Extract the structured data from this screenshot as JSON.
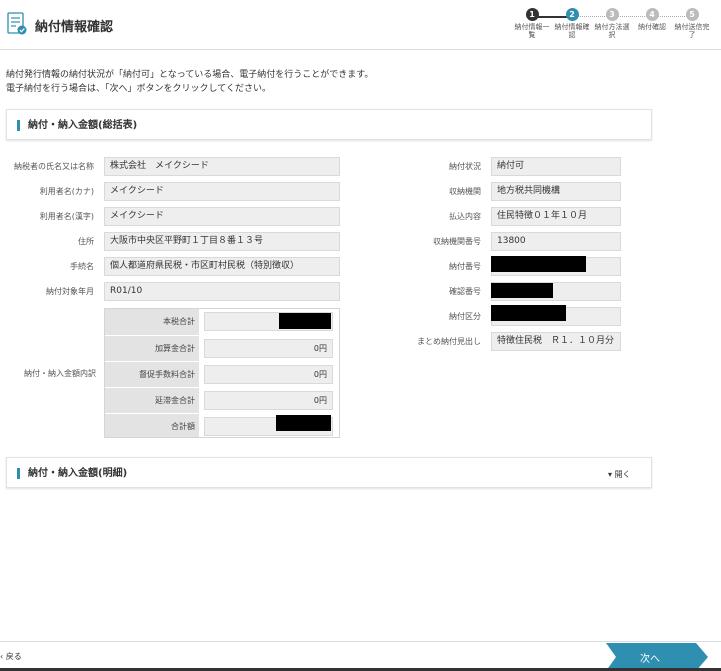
{
  "header": {
    "title": "納付情報確認"
  },
  "steps": [
    {
      "num": "1",
      "label": "納付情報一覧",
      "state": "done"
    },
    {
      "num": "2",
      "label": "納付情報確認",
      "state": "current"
    },
    {
      "num": "3",
      "label": "納付方法選択",
      "state": "todo"
    },
    {
      "num": "4",
      "label": "納付確認",
      "state": "todo"
    },
    {
      "num": "5",
      "label": "納付送信完了",
      "state": "todo"
    }
  ],
  "colors": {
    "done": "#333333",
    "current": "#2e8fb0",
    "todo": "#bbbbbb",
    "next": "#2e8fb0"
  },
  "intro": {
    "line1": "納付発行情報の納付状況が「納付可」となっている場合、電子納付を行うことができます。",
    "line2": "電子納付を行う場合は、「次へ」ボタンをクリックしてください。"
  },
  "summary": {
    "title": "納付・納入金額(総括表)",
    "left": [
      {
        "label": "納税者の氏名又は名称",
        "value": "株式会社　メイクシード"
      },
      {
        "label": "利用者名(カナ)",
        "value": "メイクシード"
      },
      {
        "label": "利用者名(漢字)",
        "value": "メイクシード"
      },
      {
        "label": "住所",
        "value": "大阪市中央区平野町１丁目８番１３号"
      },
      {
        "label": "手続名",
        "value": "個人都道府県民税・市区町村民税（特別徴収）"
      },
      {
        "label": "納付対象年月",
        "value": "R01/10"
      }
    ],
    "right": [
      {
        "label": "納付状況",
        "value": "納付可"
      },
      {
        "label": "収納機関",
        "value": "地方税共同機構"
      },
      {
        "label": "払込内容",
        "value": "住民特徴０１年１０月"
      },
      {
        "label": "収納機関番号",
        "value": "13800"
      },
      {
        "label": "納付番号",
        "value": ""
      },
      {
        "label": "確認番号",
        "value": ""
      },
      {
        "label": "納付区分",
        "value": ""
      },
      {
        "label": "まとめ納付見出し",
        "value": "特徴住民税　Ｒ１．１０月分"
      }
    ],
    "breakdown_label": "納付・納入金額内訳",
    "breakdown": [
      {
        "label": "本税合計",
        "value": ""
      },
      {
        "label": "加算金合計",
        "value": "0円"
      },
      {
        "label": "督促手数料合計",
        "value": "0円"
      },
      {
        "label": "延滞金合計",
        "value": "0円"
      },
      {
        "label": "合計額",
        "value": ""
      }
    ]
  },
  "detail": {
    "title": "納付・納入金額(明細)",
    "toggle_label": "開く"
  },
  "footer": {
    "back_label": "戻る",
    "next_label": "次へ"
  }
}
